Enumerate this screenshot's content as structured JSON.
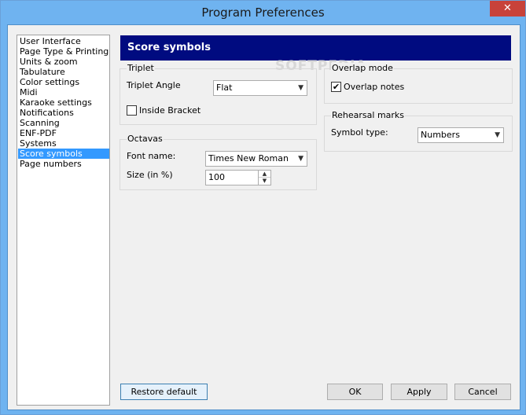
{
  "window": {
    "title": "Program Preferences",
    "close_glyph": "✕"
  },
  "nav": {
    "items": [
      "User Interface",
      "Page Type & Printing",
      "Units & zoom",
      "Tabulature",
      "Color settings",
      "Midi",
      "Karaoke settings",
      "Notifications",
      "Scanning",
      "ENF-PDF",
      "Systems",
      "Score symbols",
      "Page numbers"
    ],
    "selected": "Score symbols"
  },
  "panel": {
    "title": "Score symbols"
  },
  "watermark": "SOFTPEDIA",
  "triplet": {
    "group_label": "Triplet",
    "angle_label": "Triplet Angle",
    "angle_value": "Flat",
    "bracket_label": "Inside Bracket",
    "bracket_checked": false
  },
  "octavas": {
    "group_label": "Octavas",
    "font_label": "Font name:",
    "font_value": "Times New Roman",
    "size_label": "Size (in %)",
    "size_value": "100"
  },
  "overlap": {
    "group_label": "Overlap mode",
    "notes_label": "Overlap notes",
    "notes_checked": true,
    "check_glyph": "✔"
  },
  "rehearsal": {
    "group_label": "Rehearsal marks",
    "symbol_label": "Symbol type:",
    "symbol_value": "Numbers"
  },
  "buttons": {
    "restore": "Restore default",
    "ok": "OK",
    "apply": "Apply",
    "cancel": "Cancel"
  },
  "glyphs": {
    "dropdown": "▼",
    "spin_up": "▲",
    "spin_down": "▼"
  },
  "colors": {
    "header_bg": "#000b80",
    "selection": "#3399ff",
    "titlebar": "#6fb3f0",
    "close": "#c8423a"
  }
}
